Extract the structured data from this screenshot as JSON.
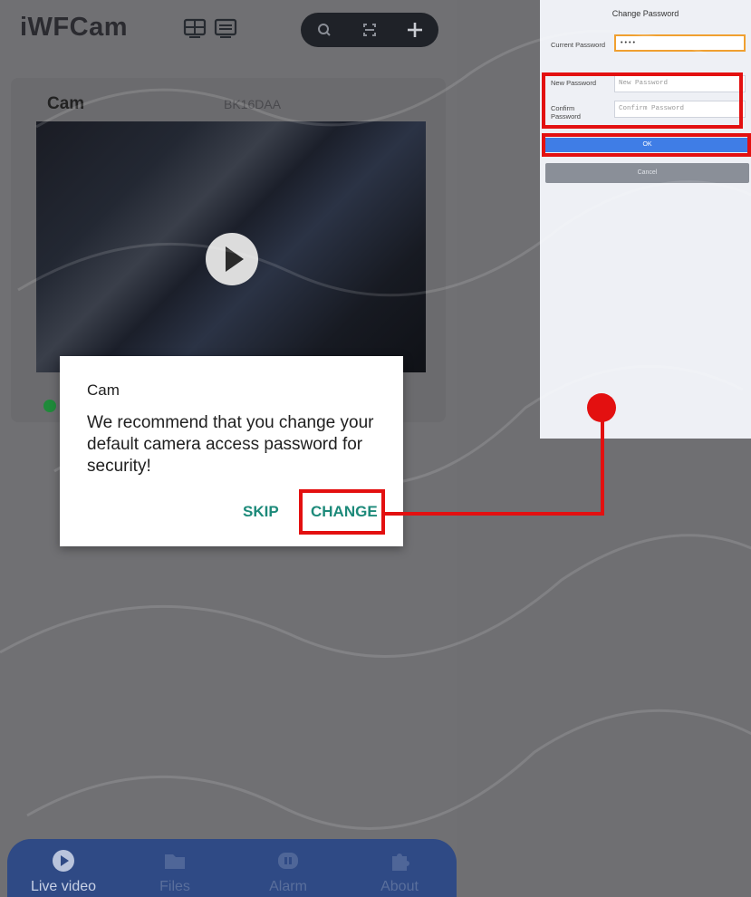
{
  "app": {
    "title": "iWFCam"
  },
  "camera": {
    "name": "Cam",
    "id": "BK16DAA"
  },
  "dialog": {
    "title": "Cam",
    "message": "We recommend that you change your default camera access password for security!",
    "skip_label": "SKIP",
    "change_label": "CHANGE"
  },
  "nav": [
    {
      "label": "Live video",
      "icon": "play-circle-icon"
    },
    {
      "label": "Files",
      "icon": "folder-icon"
    },
    {
      "label": "Alarm",
      "icon": "alarm-icon"
    },
    {
      "label": "About",
      "icon": "puzzle-icon"
    }
  ],
  "change_password": {
    "header": "Change Password",
    "current_label": "Current Password",
    "current_value": "••••",
    "new_label": "New Password",
    "new_placeholder": "New Password",
    "confirm_label": "Confirm Password",
    "confirm_placeholder": "Confirm Password",
    "ok_label": "OK",
    "cancel_label": "Cancel"
  },
  "colors": {
    "accent_teal": "#1d8a7a",
    "highlight_red": "#e31010",
    "ok_blue": "#3f7de6",
    "nav_blue": "#2f4a85"
  }
}
